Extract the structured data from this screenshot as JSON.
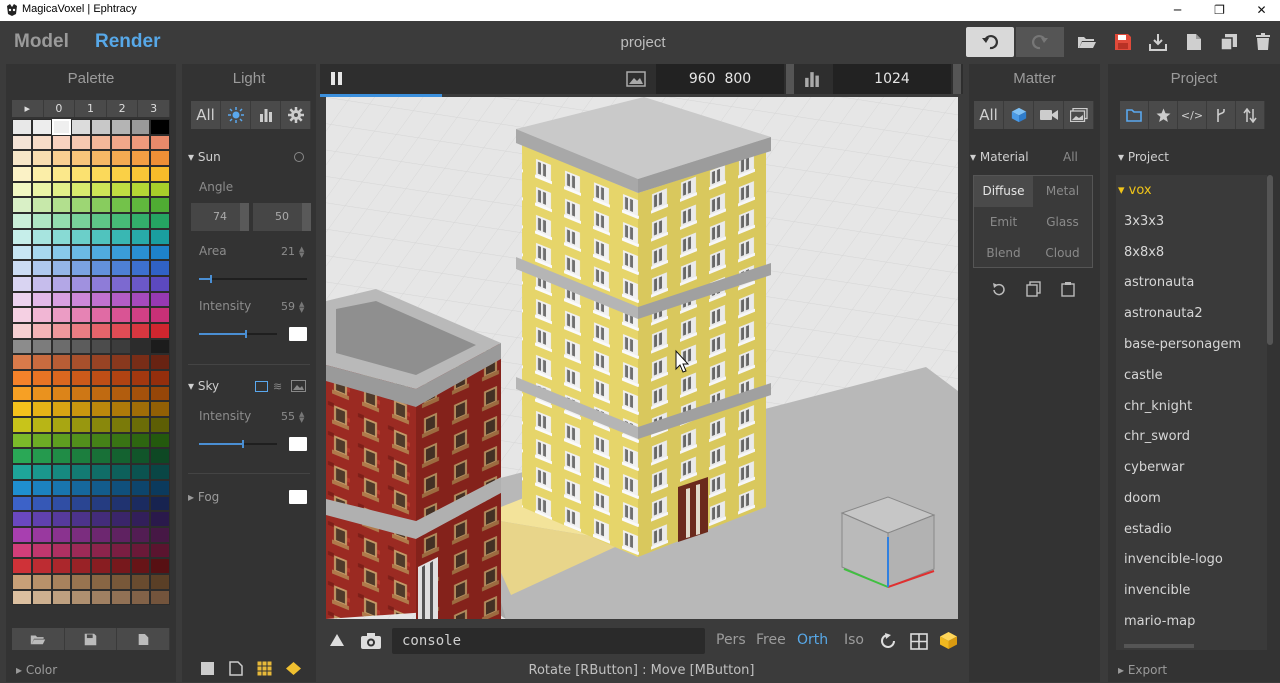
{
  "window": {
    "title": "MagicaVoxel | Ephtracy",
    "buttons": [
      "minimize-icon",
      "restore-icon",
      "close-icon"
    ]
  },
  "topbar": {
    "model_tab": "Model",
    "render_tab": "Render",
    "project_title": "project"
  },
  "palette": {
    "header": "Palette",
    "tabs": [
      "▸",
      "0",
      "1",
      "2",
      "3"
    ],
    "footer_collapse": "▸ Color"
  },
  "light": {
    "header": "Light",
    "filter_all": "All",
    "sun": {
      "title": "Sun",
      "angle_label": "Angle",
      "angle_values": [
        "74",
        "50"
      ],
      "area_label": "Area",
      "area_value": "21",
      "area_fraction": 0.1,
      "intensity_label": "Intensity",
      "intensity_value": "59",
      "intensity_fraction": 0.59
    },
    "sky": {
      "title": "Sky",
      "intensity_label": "Intensity",
      "intensity_value": "55",
      "intensity_fraction": 0.55
    },
    "fog": {
      "title": "Fog"
    }
  },
  "renderbar": {
    "width": "960",
    "height": "800",
    "samples": "1024",
    "progress_fraction": 0.19
  },
  "bottombar": {
    "console": "console",
    "camera_modes": [
      "Pers",
      "Free",
      "Orth",
      "Iso"
    ],
    "active_mode": "Orth",
    "status": "Rotate [RButton] : Move [MButton]"
  },
  "matter": {
    "header": "Matter",
    "filter_all": "All",
    "material_title": "Material",
    "material_all": "All",
    "materials": [
      "Diffuse",
      "Metal",
      "Emit",
      "Glass",
      "Blend",
      "Cloud"
    ],
    "active_material": "Diffuse"
  },
  "project": {
    "header": "Project",
    "section_title": "Project",
    "folder": "vox",
    "items": [
      "3x3x3",
      "8x8x8",
      "astronauta",
      "astronauta2",
      "base-personagem",
      "castle",
      "chr_knight",
      "chr_sword",
      "cyberwar",
      "doom",
      "estadio",
      "invencible-logo",
      "invencible",
      "mario-map"
    ],
    "export": "▸ Export"
  },
  "colors": {
    "accent": "#57a8e8",
    "background": "#3b3b3b",
    "panel": "#333333",
    "selected_folder": "#f0c419"
  }
}
